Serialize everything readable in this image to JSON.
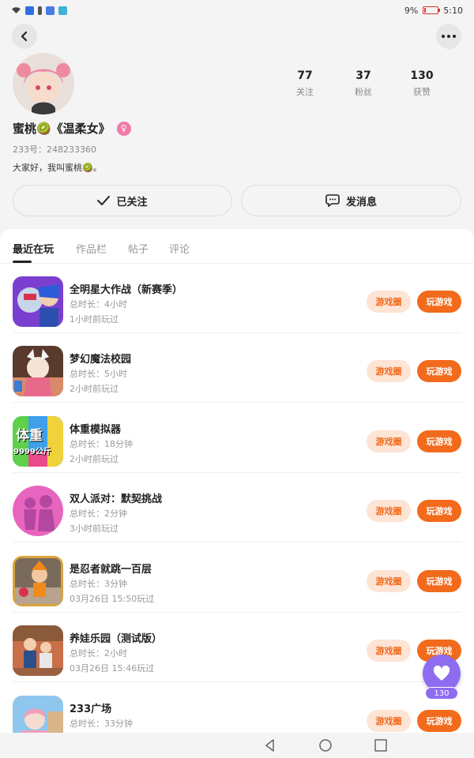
{
  "status": {
    "battery": "9%",
    "battery_level": 0.09,
    "time": "5:10"
  },
  "profile": {
    "nickname": "蜜桃🥝《温柔女》",
    "gender_symbol": "♀",
    "uid": "233号：248233360",
    "bio": "大家好，我叫蜜桃🥝。",
    "stats": [
      {
        "value": "77",
        "label": "关注"
      },
      {
        "value": "37",
        "label": "粉丝"
      },
      {
        "value": "130",
        "label": "获赞"
      }
    ],
    "follow_label": "已关注",
    "message_label": "发消息"
  },
  "tabs": [
    "最近在玩",
    "作品栏",
    "帖子",
    "评论"
  ],
  "games": [
    {
      "title": "全明星大作战（新赛季）",
      "duration": "总时长：4小时",
      "last": "1小时前玩过",
      "circle": "游戏圈",
      "play": "玩游戏"
    },
    {
      "title": "梦幻魔法校园",
      "duration": "总时长：5小时",
      "last": "2小时前玩过",
      "circle": "游戏圈",
      "play": "玩游戏"
    },
    {
      "title": "体重模拟器",
      "duration": "总时长：18分钟",
      "last": "2小时前玩过",
      "circle": "游戏圈",
      "play": "玩游戏",
      "icon_text_1": "体重",
      "icon_text_2": "9999公斤"
    },
    {
      "title": "双人派对：默契挑战",
      "duration": "总时长：2分钟",
      "last": "3小时前玩过",
      "circle": "游戏圈",
      "play": "玩游戏"
    },
    {
      "title": "是忍者就跳一百层",
      "duration": "总时长：3分钟",
      "last": "03月26日 15:50玩过",
      "circle": "游戏圈",
      "play": "玩游戏"
    },
    {
      "title": "养娃乐园（测试版）",
      "duration": "总时长：2小时",
      "last": "03月26日 15:46玩过",
      "circle": "游戏圈",
      "play": "玩游戏"
    },
    {
      "title": "233广场",
      "duration": "总时长：33分钟",
      "last": "",
      "circle": "游戏圈",
      "play": "玩游戏"
    }
  ],
  "like_count": "130",
  "colors": {
    "accent": "#f26a1b",
    "accent_soft": "#fde4d4",
    "like": "#8e6cf0",
    "gender": "#f07aa7"
  }
}
